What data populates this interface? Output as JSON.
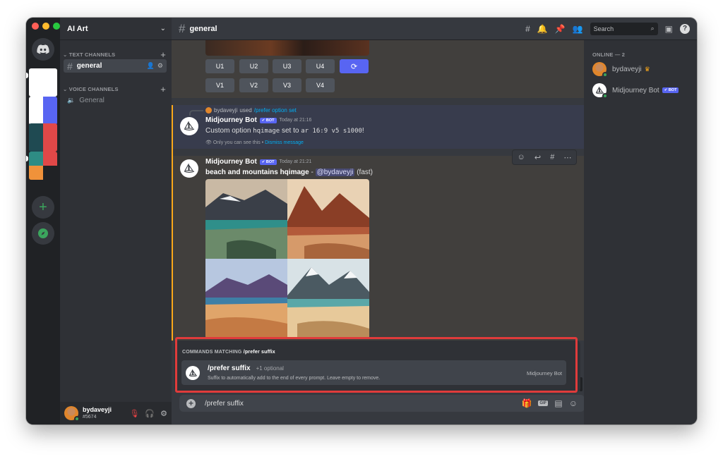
{
  "server": {
    "name": "AI Art",
    "categories": {
      "text": "TEXT CHANNELS",
      "voice": "VOICE CHANNELS"
    },
    "channels": {
      "text": [
        "general"
      ],
      "voice": [
        "General"
      ]
    }
  },
  "topbar": {
    "channel": "general",
    "search_placeholder": "Search"
  },
  "messages": {
    "grid_buttons": {
      "upscale": [
        "U1",
        "U2",
        "U3",
        "U4"
      ],
      "variation": [
        "V1",
        "V2",
        "V3",
        "V4"
      ],
      "reroll_icon": "refresh-icon"
    },
    "ephemeral": {
      "reply_user": "bydaveyji",
      "reply_used": "used",
      "reply_command": "/prefer option set",
      "author": "Midjourney Bot",
      "badge": "✔ BOT",
      "timestamp": "Today at 21:16",
      "text_prefix": "Custom option ",
      "option_name": "hqimage",
      "text_middle": " set to ",
      "option_value": "ar 16:9 v5 s1000",
      "text_suffix": "!",
      "note": "Only you can see this • ",
      "dismiss": "Dismiss message"
    },
    "grid_message": {
      "author": "Midjourney Bot",
      "badge": "✔ BOT",
      "timestamp": "Today at 21:21",
      "prompt": "beach and mountains hqimage",
      "dash": " - ",
      "mention": "@bydaveyji",
      "speed": "(fast)"
    }
  },
  "autocomplete": {
    "heading_prefix": "COMMANDS MATCHING ",
    "heading_query": "/prefer suffix",
    "command": "/prefer suffix",
    "optional": "+1 optional",
    "description": "Suffix to automatically add to the end of every prompt. Leave empty to remove.",
    "source": "Midjourney Bot"
  },
  "composer": {
    "value": "/prefer suffix"
  },
  "user_panel": {
    "name": "bydaveyji",
    "tag": "#5674"
  },
  "members": {
    "heading": "ONLINE — 2",
    "list": [
      {
        "name": "bydaveyji",
        "crown": "♛"
      },
      {
        "name": "Midjourney Bot",
        "badge": "✔ BOT"
      }
    ]
  },
  "colors": {
    "accent": "#5865f2",
    "online": "#3ba55d",
    "highlight_bar": "#faa81a",
    "callout_border": "#e03b3b"
  }
}
